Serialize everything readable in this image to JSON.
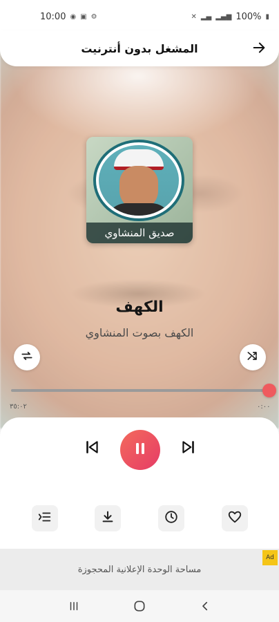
{
  "status_bar": {
    "time": "10:00",
    "battery": "100%"
  },
  "header": {
    "title": "المشغل بدون أنترنيت",
    "back_icon": "arrow-right-icon"
  },
  "cover": {
    "caption": "صديق المنشاوي"
  },
  "track": {
    "title": "الكهف",
    "subtitle": "الكهف بصوت المنشاوي"
  },
  "progress": {
    "elapsed": "٠:٠٠",
    "duration": "٣٥:٠٢",
    "fraction": 0.0
  },
  "controls": {
    "repeat_icon": "repeat-icon",
    "shuffle_icon": "shuffle-icon",
    "prev_icon": "skip-previous-icon",
    "play_icon": "pause-icon",
    "next_icon": "skip-next-icon"
  },
  "actions": {
    "playlist_icon": "playlist-icon",
    "download_icon": "download-icon",
    "timer_icon": "clock-icon",
    "favorite_icon": "heart-icon"
  },
  "ad": {
    "text": "مساحة الوحدة الإعلانية المحجوزة",
    "badge": "Ad"
  },
  "colors": {
    "accent": "#e74a5a",
    "accent_gradient_start": "#f36a5c"
  }
}
